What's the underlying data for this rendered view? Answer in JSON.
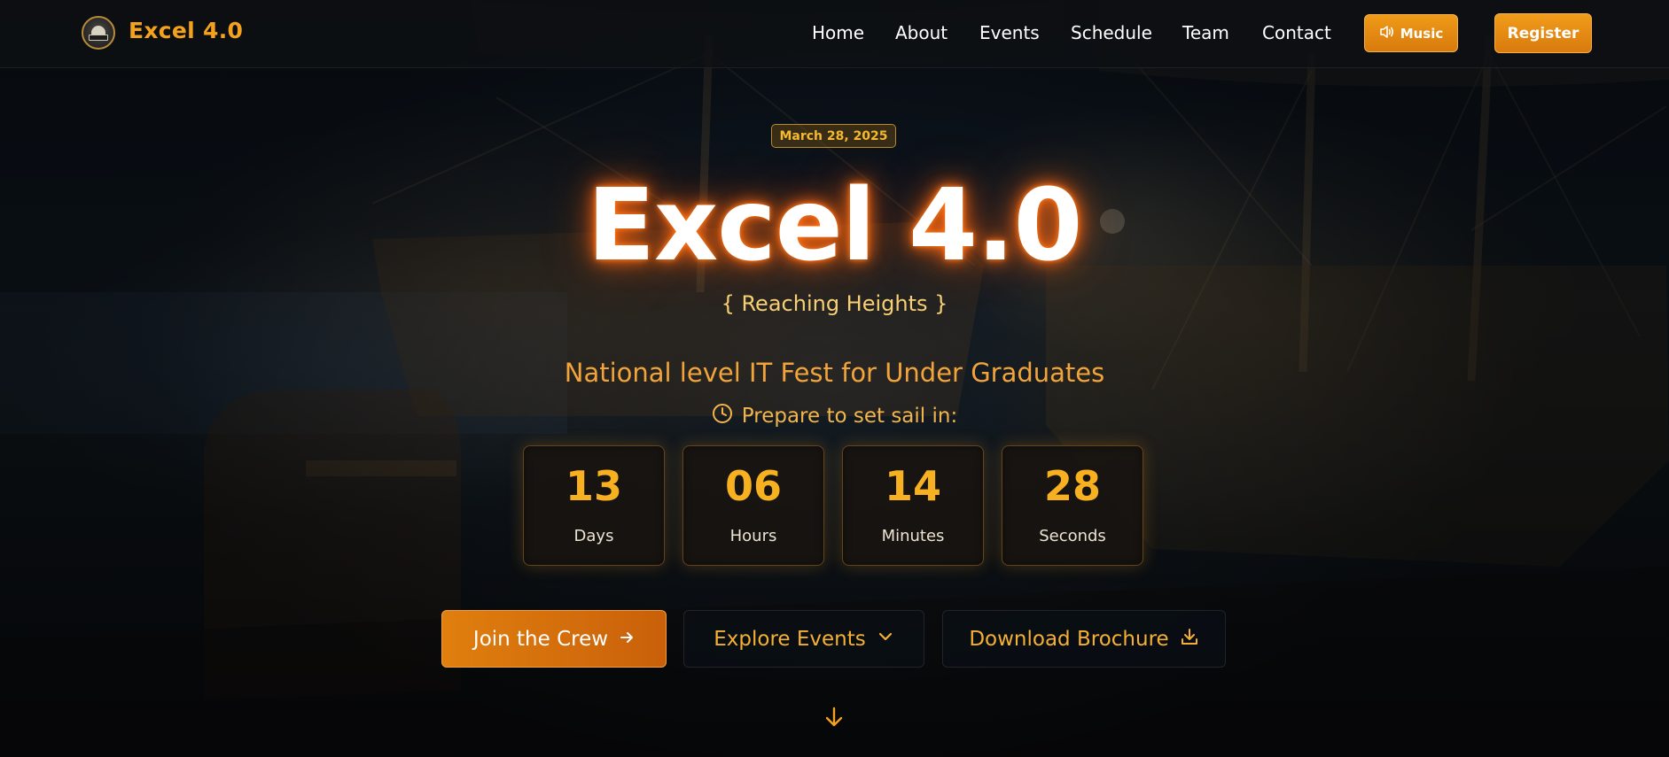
{
  "brand": {
    "name": "Excel 4.0"
  },
  "nav": {
    "items": [
      {
        "label": "Home"
      },
      {
        "label": "About"
      },
      {
        "label": "Events"
      },
      {
        "label": "Schedule"
      },
      {
        "label": "Team"
      },
      {
        "label": "Contact"
      }
    ],
    "music_label": "Music",
    "register_label": "Register"
  },
  "hero": {
    "date": "March 28, 2025",
    "title": "Excel 4.0",
    "tagline": "{ Reaching Heights }",
    "subtitle": "National level IT Fest for Under Graduates",
    "countdown_prompt": "Prepare to set sail in:",
    "countdown": [
      {
        "value": "13",
        "label": "Days"
      },
      {
        "value": "06",
        "label": "Hours"
      },
      {
        "value": "14",
        "label": "Minutes"
      },
      {
        "value": "28",
        "label": "Seconds"
      }
    ]
  },
  "actions": {
    "join_label": "Join the Crew",
    "explore_label": "Explore Events",
    "brochure_label": "Download Brochure"
  },
  "icons": {
    "music": "speaker-icon",
    "clock": "clock-icon",
    "join": "arrow-right-icon",
    "explore": "chevron-down-icon",
    "brochure": "download-icon",
    "scroll": "arrow-down-icon"
  },
  "colors": {
    "accent": "#f4a21e",
    "accent_dark": "#d87a0c",
    "title_glow": "#ff6a10",
    "count_number": "#f7b020",
    "tagline": "#f7d074"
  }
}
